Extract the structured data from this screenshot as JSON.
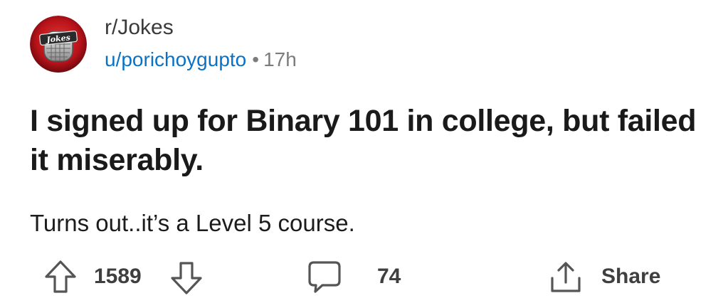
{
  "post": {
    "subreddit": "r/Jokes",
    "subreddit_icon_text": "Jokes",
    "author": "u/porichoygupto",
    "separator": "•",
    "age": "17h",
    "title": "I signed up for Binary 101 in college, but failed it miserably.",
    "body": "Turns out..it’s a Level 5 course."
  },
  "actions": {
    "score": "1589",
    "comments": "74",
    "share_label": "Share"
  },
  "colors": {
    "author_link": "#0a72c6",
    "meta_gray": "#7c7c7c",
    "avatar_red": "#c8161d"
  },
  "icons": [
    "upvote-icon",
    "downvote-icon",
    "comment-icon",
    "share-icon",
    "subreddit-avatar"
  ]
}
